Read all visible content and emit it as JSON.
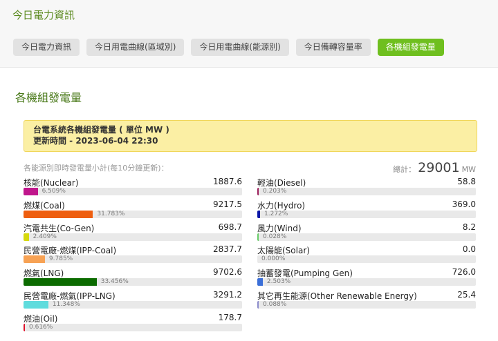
{
  "header": {
    "app_title": "今日電力資訊",
    "tabs": [
      {
        "label": "今日電力資訊"
      },
      {
        "label": "今日用電曲線(區域別)"
      },
      {
        "label": "今日用電曲線(能源別)"
      },
      {
        "label": "今日備轉容量率"
      },
      {
        "label": "各機組發電量"
      }
    ]
  },
  "section_title": "各機組發電量",
  "notice": {
    "line1": "台電系統各機組發電量 ( 單位 MW )",
    "line2": "更新時間 - 2023-06-04 22:30"
  },
  "summary": {
    "subtitle": "各能源別即時發電量小計(每10分鐘更新)：",
    "total_label": "總計：",
    "total_value": "29001",
    "total_unit": "MW"
  },
  "sources_left": [
    {
      "name": "核能(Nuclear)",
      "value": "1887.6",
      "pct": "6.509%",
      "ratio": 0.06509,
      "color": "#c0168c"
    },
    {
      "name": "燃煤(Coal)",
      "value": "9217.5",
      "pct": "31.783%",
      "ratio": 0.31783,
      "color": "#ee5e0f"
    },
    {
      "name": "汽電共生(Co-Gen)",
      "value": "698.7",
      "pct": "2.409%",
      "ratio": 0.02409,
      "color": "#d6d90e"
    },
    {
      "name": "民營電廠-燃煤(IPP-Coal)",
      "value": "2837.7",
      "pct": "9.785%",
      "ratio": 0.09785,
      "color": "#f7a254"
    },
    {
      "name": "燃氣(LNG)",
      "value": "9702.6",
      "pct": "33.456%",
      "ratio": 0.33456,
      "color": "#0b6b00"
    },
    {
      "name": "民營電廠-燃氣(IPP-LNG)",
      "value": "3291.2",
      "pct": "11.348%",
      "ratio": 0.11348,
      "color": "#5fdcdd"
    },
    {
      "name": "燃油(Oil)",
      "value": "178.7",
      "pct": "0.616%",
      "ratio": 0.00616,
      "color": "#e0122b"
    }
  ],
  "sources_right": [
    {
      "name": "輕油(Diesel)",
      "value": "58.8",
      "pct": "0.203%",
      "ratio": 0.00203,
      "color": "#9b1d5a"
    },
    {
      "name": "水力(Hydro)",
      "value": "369.0",
      "pct": "1.272%",
      "ratio": 0.01272,
      "color": "#0a18a8"
    },
    {
      "name": "風力(Wind)",
      "value": "8.2",
      "pct": "0.028%",
      "ratio": 0.00028,
      "color": "#66cc66"
    },
    {
      "name": "太陽能(Solar)",
      "value": "0.0",
      "pct": "0.000%",
      "ratio": 0.0,
      "color": "#f2c200"
    },
    {
      "name": "抽蓄發電(Pumping Gen)",
      "value": "726.0",
      "pct": "2.503%",
      "ratio": 0.02503,
      "color": "#3b6fd8"
    },
    {
      "name": "其它再生能源(Other Renewable Energy)",
      "value": "25.4",
      "pct": "0.088%",
      "ratio": 0.00088,
      "color": "#8a8acb"
    }
  ]
}
